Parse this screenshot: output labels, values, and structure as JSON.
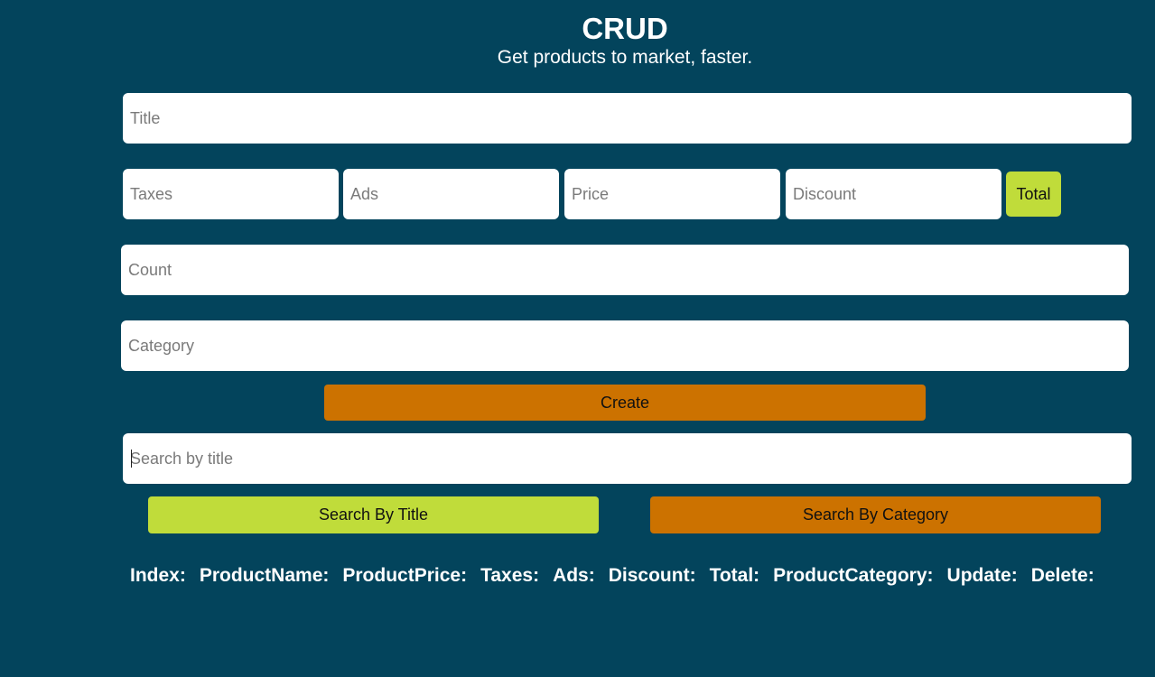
{
  "header": {
    "title": "CRUD",
    "subtitle": "Get products to market, faster."
  },
  "form": {
    "title_placeholder": "Title",
    "taxes_placeholder": "Taxes",
    "ads_placeholder": "Ads",
    "price_placeholder": "Price",
    "discount_placeholder": "Discount",
    "total_label": "Total",
    "count_placeholder": "Count",
    "category_placeholder": "Category",
    "create_label": "Create"
  },
  "search": {
    "placeholder": "Search by title",
    "by_title_label": "Search By Title",
    "by_category_label": "Search By Category"
  },
  "table": {
    "headers": [
      "Index:",
      "ProductName:",
      "ProductPrice:",
      "Taxes:",
      "Ads:",
      "Discount:",
      "Total:",
      "ProductCategory:",
      "Update:",
      "Delete:"
    ]
  },
  "colors": {
    "background": "#03445c",
    "total_button": "#c0dc3a",
    "create_button": "#cc7200",
    "search_title_button": "#c0dc3a",
    "search_category_button": "#cc7200"
  }
}
